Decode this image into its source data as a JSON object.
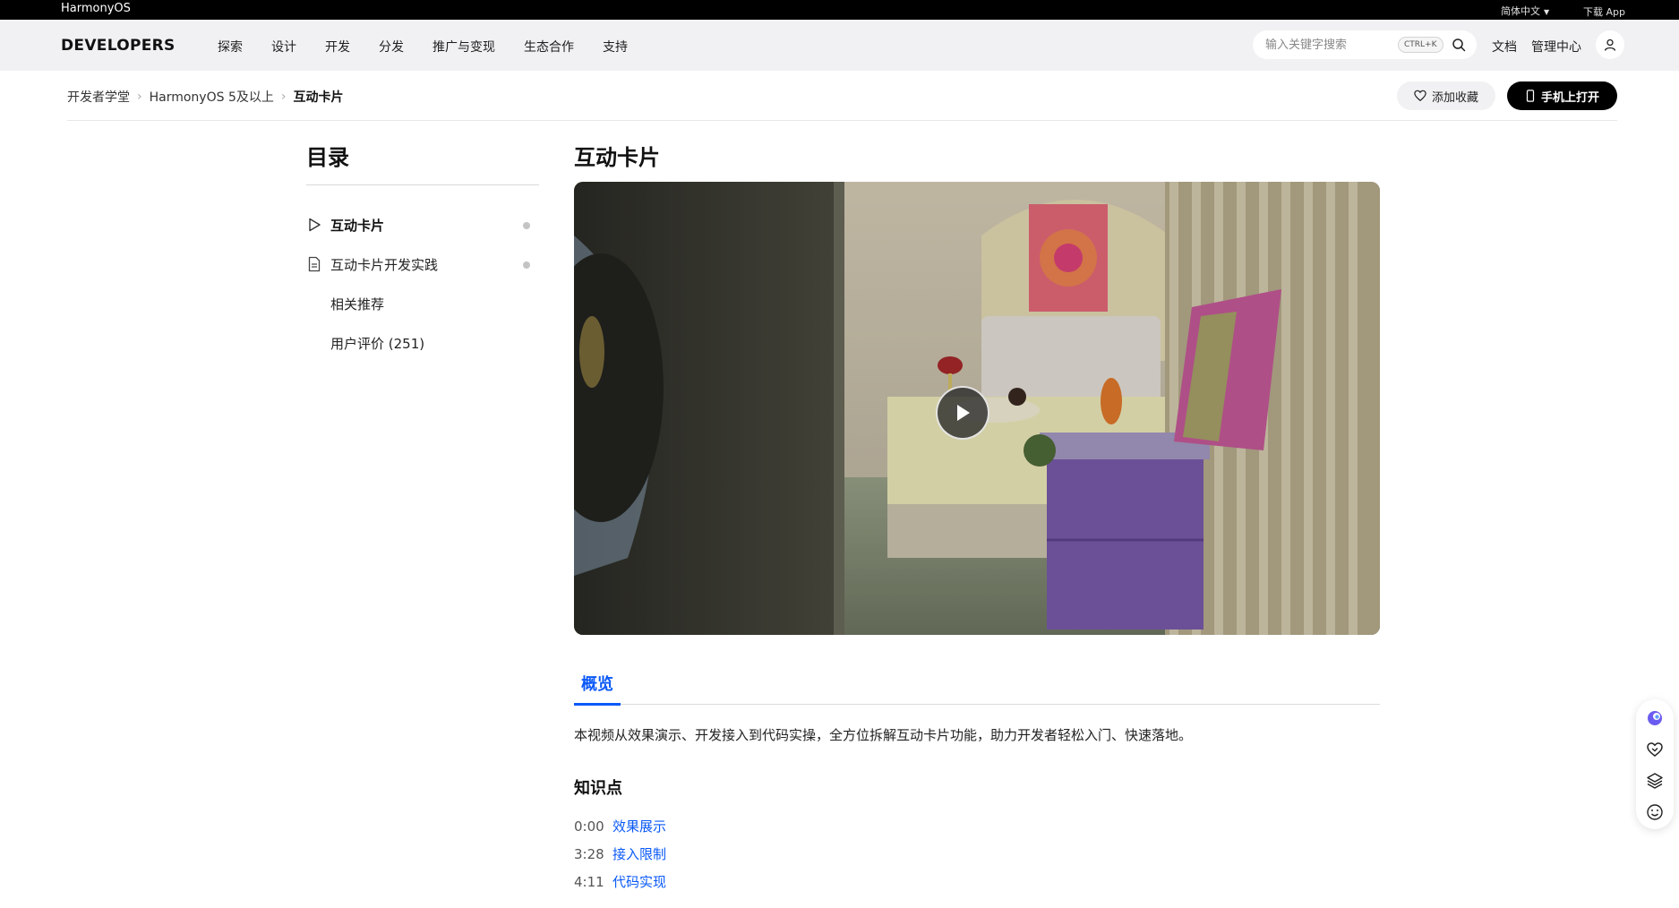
{
  "topbar": {
    "brand": "HarmonyOS",
    "language": "简体中文",
    "download_app": "下载 App"
  },
  "nav": {
    "logo": "DEVELOPERS",
    "menu": [
      "探索",
      "设计",
      "开发",
      "分发",
      "推广与变现",
      "生态合作",
      "支持"
    ],
    "search_placeholder": "输入关键字搜索",
    "search_shortcut": "CTRL+K",
    "docs": "文档",
    "console": "管理中心"
  },
  "breadcrumb": [
    "开发者学堂",
    "HarmonyOS 5及以上",
    "互动卡片"
  ],
  "actions": {
    "favorite": "添加收藏",
    "open_on_phone": "手机上打开"
  },
  "toc": {
    "title": "目录",
    "items": [
      {
        "label": "互动卡片",
        "icon": "play-outline-icon"
      },
      {
        "label": "互动卡片开发实践",
        "icon": "document-icon"
      },
      {
        "label": "相关推荐"
      },
      {
        "label": "用户评价 (251)"
      }
    ]
  },
  "main": {
    "title": "互动卡片",
    "tab": "概览",
    "description": "本视频从效果演示、开发接入到代码实操，全方位拆解互动卡片功能，助力开发者轻松入门、快速落地。",
    "knowledge_title": "知识点",
    "knowledge_points": [
      {
        "time": "0:00",
        "label": "效果展示"
      },
      {
        "time": "3:28",
        "label": "接入限制"
      },
      {
        "time": "4:11",
        "label": "代码实现"
      }
    ]
  },
  "colors": {
    "accent": "#0a59f7",
    "topbar": "#000000",
    "navbar": "#f1f1f3"
  }
}
